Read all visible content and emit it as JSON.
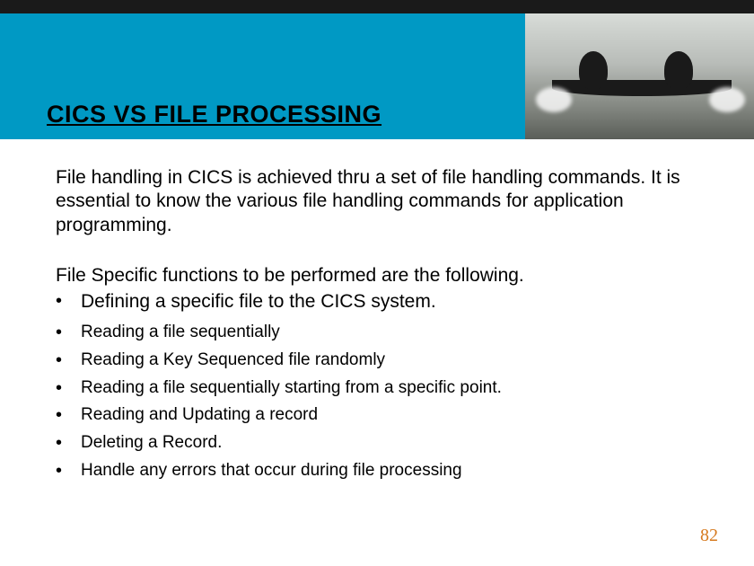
{
  "slide": {
    "title": "CICS VS FILE PROCESSING",
    "intro": "File handling in CICS is achieved thru a set of file handling commands. It is essential to know the various file handling commands for application programming.",
    "sectionHeading": "File Specific functions to be  performed are the following.",
    "bullets": [
      "Defining a specific file to the CICS system.",
      "Reading a file sequentially",
      "Reading a Key Sequenced file randomly",
      "Reading a file sequentially starting from a specific point.",
      "Reading and Updating a record",
      "Deleting a Record.",
      "Handle any errors that occur during file processing"
    ],
    "pageNumber": "82"
  }
}
